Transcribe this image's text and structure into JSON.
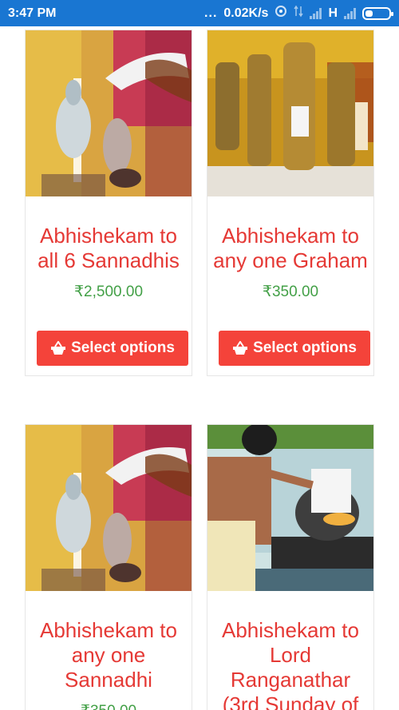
{
  "status_bar": {
    "time": "3:47 PM",
    "dots": "...",
    "speed": "0.02K/s",
    "network": "H"
  },
  "products": [
    {
      "title": "Abhishekam to all 6 Sannadhis",
      "price": "₹2,500.00",
      "button": "Select options",
      "image": "milk-abhishekam-icon"
    },
    {
      "title": "Abhishekam to any one Graham",
      "price": "₹350.00",
      "button": "Select options",
      "image": "brass-idols-icon"
    },
    {
      "title": "Abhishekam to any one Sannadhi",
      "price": "₹350.00",
      "button": "Select options",
      "image": "milk-abhishekam-icon"
    },
    {
      "title": "Abhishekam to Lord Ranganathar (3rd Sunday of",
      "price": "",
      "button": "",
      "image": "priest-ritual-icon"
    }
  ],
  "colors": {
    "status_bar": "#1976d2",
    "title": "#e53935",
    "price": "#43a047",
    "button": "#f4433a"
  }
}
